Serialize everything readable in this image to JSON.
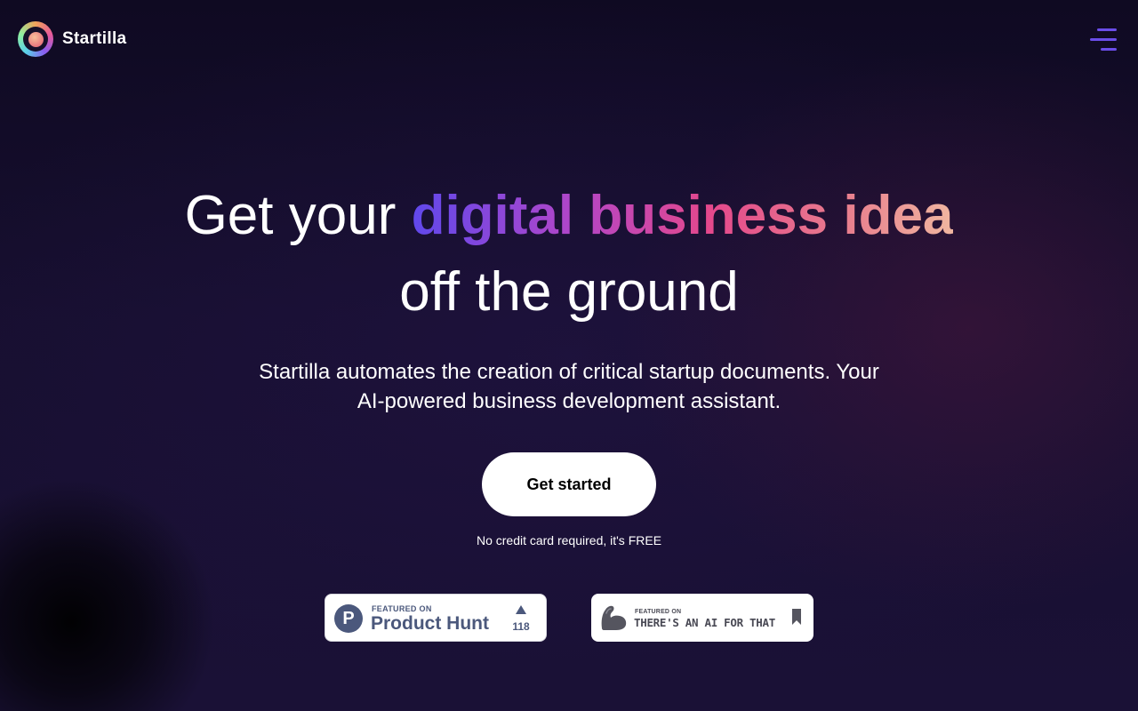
{
  "header": {
    "brand_name": "Startilla",
    "logo_icon": "startilla-logo-icon",
    "menu_icon": "hamburger-menu-icon",
    "accent_color": "#6a4de8"
  },
  "hero": {
    "title_prefix": "Get your ",
    "title_highlight": "digital business idea",
    "title_suffix": "off the ground",
    "highlight_gradient": [
      "#6048ec",
      "#b246c8",
      "#e4488c",
      "#e87d8d",
      "#f0b6a0"
    ],
    "subtitle": "Startilla automates the creation of critical startup documents. Your AI-powered business development assistant.",
    "cta_label": "Get started",
    "cta_note": "No credit card required, it's FREE"
  },
  "badges": {
    "product_hunt": {
      "logo_letter": "P",
      "featured_label": "FEATURED ON",
      "name": "Product Hunt",
      "upvotes": "118",
      "color": "#4b587c"
    },
    "ai_for_that": {
      "featured_label": "FEATURED ON",
      "name": "THERE'S AN AI FOR THAT",
      "icon": "flexed-arm-icon",
      "bookmark_icon": "bookmark-icon"
    }
  },
  "background_color": "#140d28"
}
